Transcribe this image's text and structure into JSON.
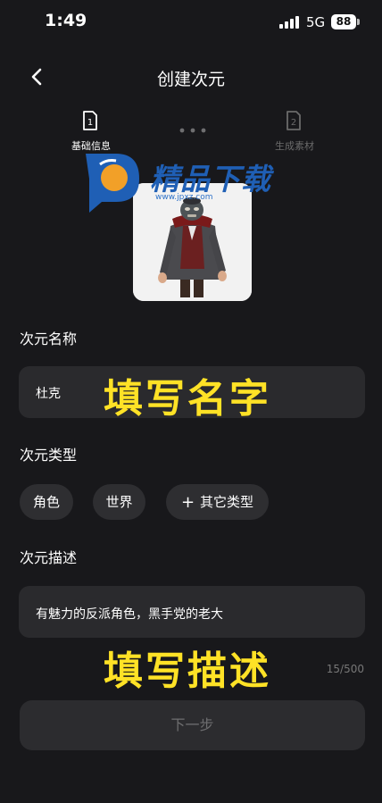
{
  "status_bar": {
    "time": "1:49",
    "network": "5G",
    "battery": "88"
  },
  "header": {
    "title": "创建次元"
  },
  "steps": [
    {
      "number": "1",
      "label": "基础信息",
      "active": true
    },
    {
      "number": "2",
      "label": "生成素材",
      "active": false
    }
  ],
  "watermark": {
    "text": "精品下载",
    "url": "www.jpxz.com"
  },
  "name_section": {
    "label": "次元名称",
    "value": "杜克",
    "overlay": "填写名字"
  },
  "type_section": {
    "label": "次元类型",
    "options": [
      {
        "label": "角色"
      },
      {
        "label": "世界"
      },
      {
        "label": "其它类型"
      }
    ]
  },
  "desc_section": {
    "label": "次元描述",
    "value": "有魅力的反派角色，黑手党的老大",
    "overlay": "填写描述",
    "counter": "15/500"
  },
  "footer": {
    "next_label": "下一步"
  },
  "colors": {
    "background": "#18181b",
    "field": "#2a2a2d",
    "overlay_yellow": "#ffe226",
    "watermark_blue": "#1f5fb5"
  }
}
